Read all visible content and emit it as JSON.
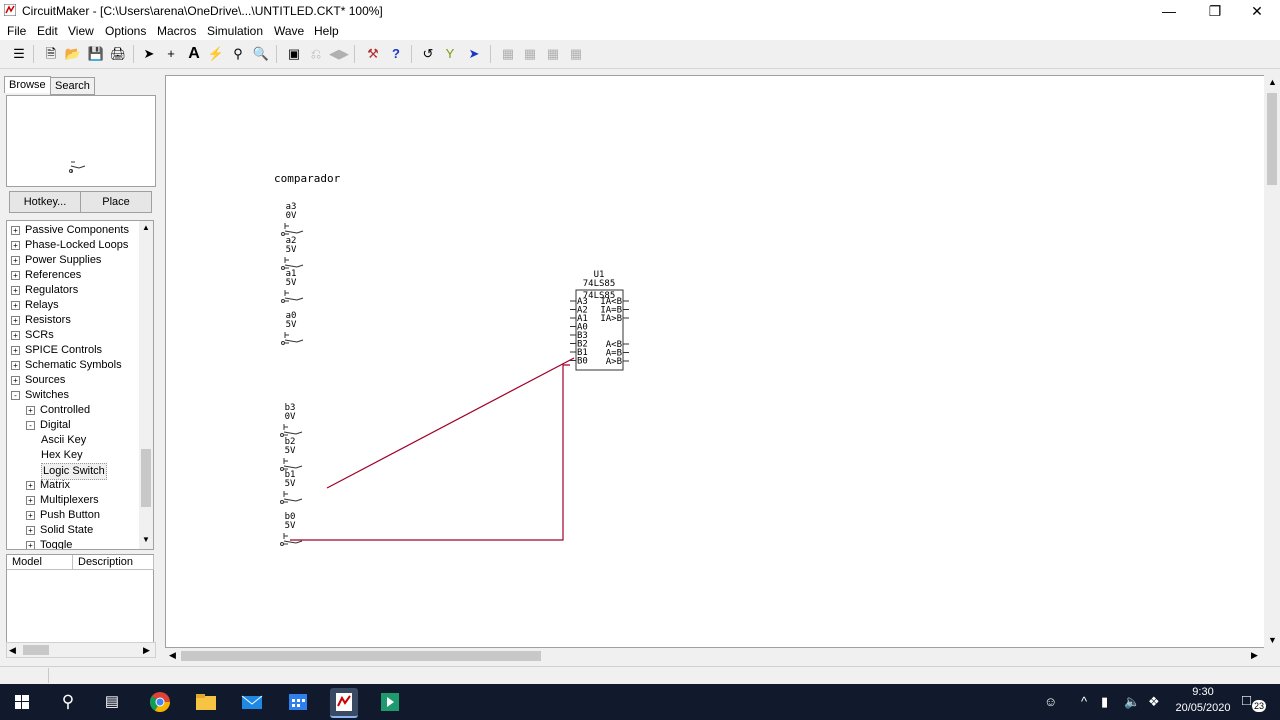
{
  "window": {
    "title": "CircuitMaker - [C:\\Users\\arena\\OneDrive\\...\\UNTITLED.CKT* 100%]",
    "minimize": "—",
    "restore": "❐",
    "close": "✕"
  },
  "menu": [
    "File",
    "Edit",
    "View",
    "Options",
    "Macros",
    "Simulation",
    "Wave",
    "Help"
  ],
  "toolbar": {
    "icons": [
      "new-icon",
      "open-icon",
      "save-icon",
      "print-icon",
      "arrow-tool-icon",
      "wire-tool-icon",
      "text-tool-icon",
      "probe-tool-icon",
      "zoom-tool-icon"
    ]
  },
  "left": {
    "tabs": [
      "Browse",
      "Search"
    ],
    "hotkey_button": "Hotkey...",
    "place_button": "Place",
    "tree": [
      {
        "label": "Passive Components",
        "level": 0,
        "sign": "+"
      },
      {
        "label": "Phase-Locked Loops",
        "level": 0,
        "sign": "+"
      },
      {
        "label": "Power Supplies",
        "level": 0,
        "sign": "+"
      },
      {
        "label": "References",
        "level": 0,
        "sign": "+"
      },
      {
        "label": "Regulators",
        "level": 0,
        "sign": "+"
      },
      {
        "label": "Relays",
        "level": 0,
        "sign": "+"
      },
      {
        "label": "Resistors",
        "level": 0,
        "sign": "+"
      },
      {
        "label": "SCRs",
        "level": 0,
        "sign": "+"
      },
      {
        "label": "SPICE Controls",
        "level": 0,
        "sign": "+"
      },
      {
        "label": "Schematic Symbols",
        "level": 0,
        "sign": "+"
      },
      {
        "label": "Sources",
        "level": 0,
        "sign": "+"
      },
      {
        "label": "Switches",
        "level": 0,
        "sign": "-"
      },
      {
        "label": "Controlled",
        "level": 1,
        "sign": "+"
      },
      {
        "label": "Digital",
        "level": 1,
        "sign": "-"
      },
      {
        "label": "Ascii Key",
        "level": 2,
        "sign": ""
      },
      {
        "label": "Hex Key",
        "level": 2,
        "sign": ""
      },
      {
        "label": "Logic Switch",
        "level": 2,
        "sign": "",
        "selected": true
      },
      {
        "label": "Matrix",
        "level": 1,
        "sign": "+"
      },
      {
        "label": "Multiplexers",
        "level": 1,
        "sign": "+"
      },
      {
        "label": "Push Button",
        "level": 1,
        "sign": "+"
      },
      {
        "label": "Solid State",
        "level": 1,
        "sign": "+"
      },
      {
        "label": "Toggle",
        "level": 1,
        "sign": "+"
      }
    ],
    "columns": [
      "Model",
      "Description"
    ]
  },
  "canvas": {
    "title": "comparador",
    "switches_a": [
      {
        "name": "a3",
        "value": "0V"
      },
      {
        "name": "a2",
        "value": "5V"
      },
      {
        "name": "a1",
        "value": "5V"
      },
      {
        "name": "a0",
        "value": "5V"
      }
    ],
    "switches_b": [
      {
        "name": "b3",
        "value": "0V"
      },
      {
        "name": "b2",
        "value": "5V"
      },
      {
        "name": "b1",
        "value": "5V"
      },
      {
        "name": "b0",
        "value": "5V"
      }
    ],
    "chip": {
      "ref": "U1",
      "part": "74LS85",
      "inner_part": "74LS85",
      "left_pins": [
        "A3",
        "A2",
        "A1",
        "A0",
        "B3",
        "B2",
        "B1",
        "B0"
      ],
      "right_pins_top": [
        "IA<B",
        "IA=B",
        "IA>B"
      ],
      "right_pins_bottom": [
        "A<B",
        "A=B",
        "A>B"
      ]
    },
    "wire_color": "#a00028"
  },
  "taskbar": {
    "time": "9:30",
    "date": "20/05/2020",
    "notifications": "23"
  }
}
